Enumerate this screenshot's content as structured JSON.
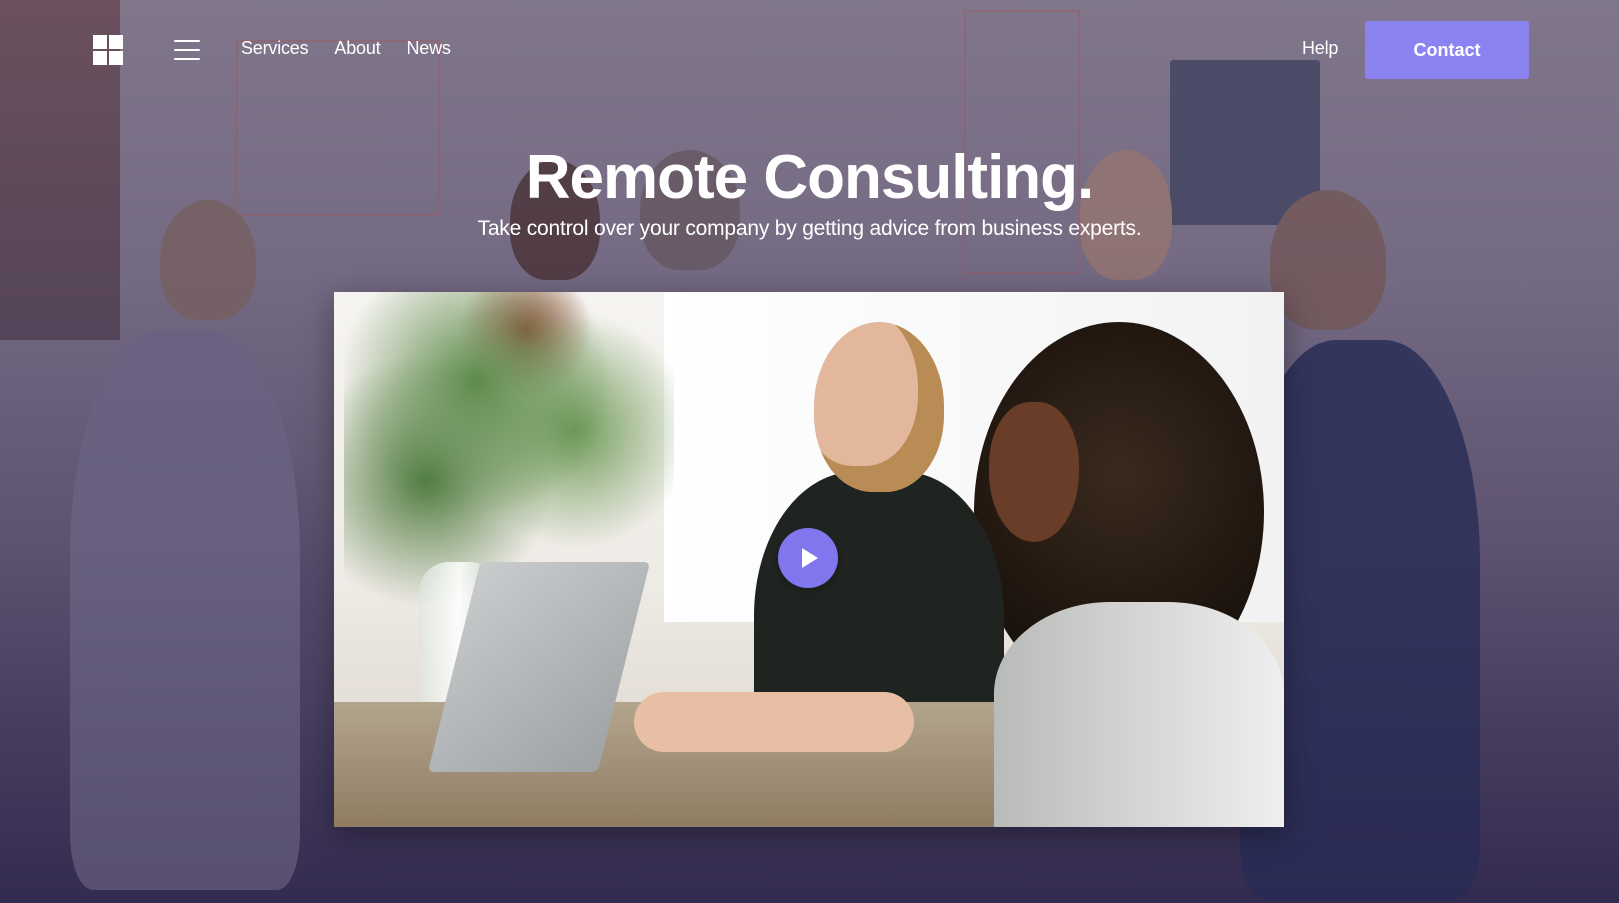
{
  "nav": {
    "logo_icon": "windows-grid-icon",
    "menu_icon": "hamburger-menu-icon",
    "links": [
      {
        "label": "Services"
      },
      {
        "label": "About"
      },
      {
        "label": "News"
      }
    ],
    "help_label": "Help",
    "contact_label": "Contact"
  },
  "hero": {
    "title": "Remote Consulting.",
    "subtitle": "Take control over your company by getting advice from business experts."
  },
  "video": {
    "play_icon": "play-icon"
  },
  "colors": {
    "accent": "#8c83f3",
    "play_button": "#8077ef",
    "text": "#ffffff"
  }
}
